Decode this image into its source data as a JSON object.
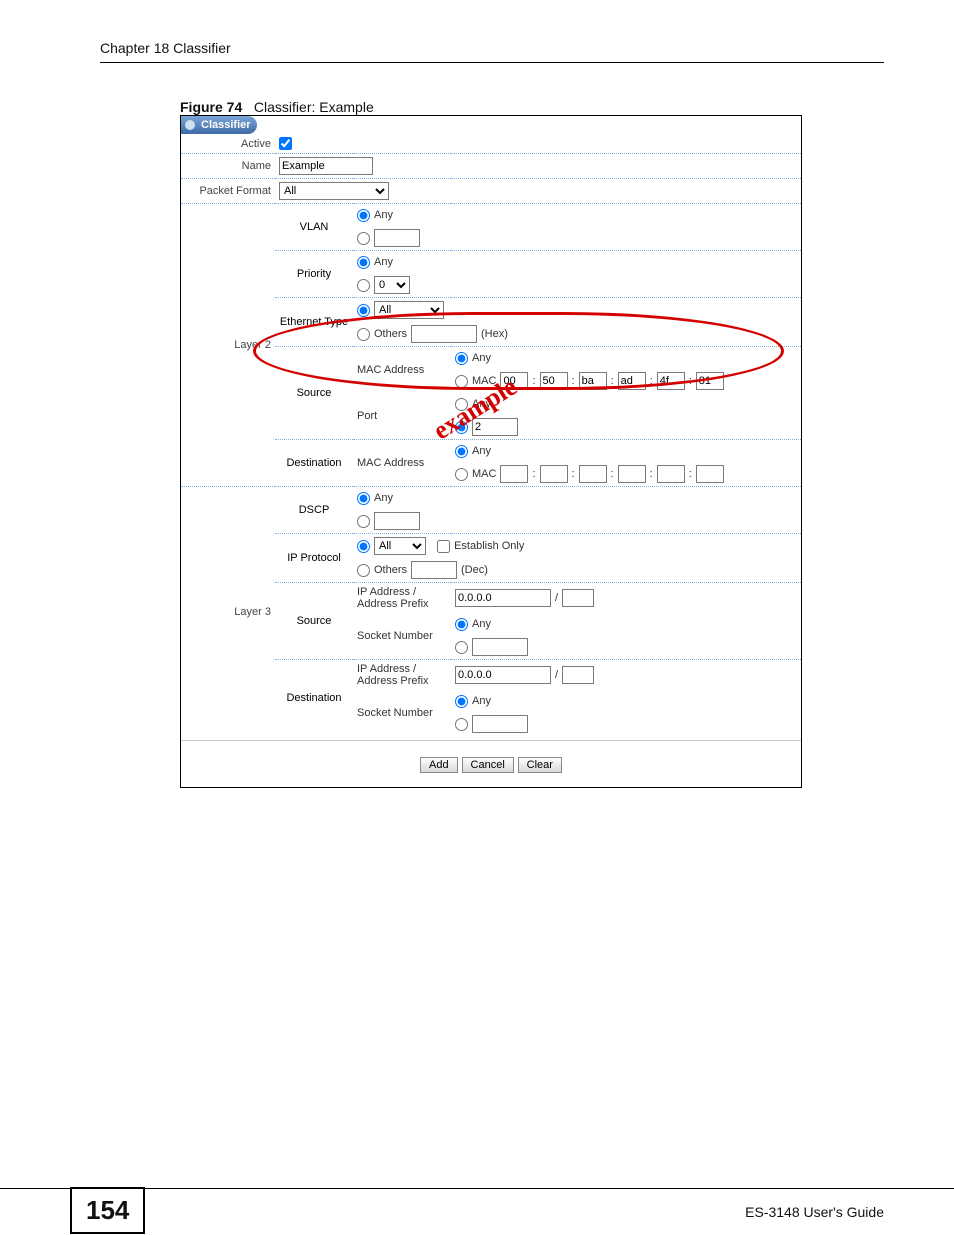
{
  "header": {
    "chapter": "Chapter 18 Classifier"
  },
  "figure": {
    "label": "Figure 74",
    "caption": "Classifier: Example"
  },
  "tab": {
    "title": "Classifier"
  },
  "rows": {
    "active": "Active",
    "name": "Name",
    "name_value": "Example",
    "packet_format": "Packet Format",
    "packet_format_value": "All"
  },
  "layer2": {
    "title": "Layer 2",
    "vlan": {
      "label": "VLAN",
      "any": "Any"
    },
    "priority": {
      "label": "Priority",
      "any": "Any",
      "value": "0"
    },
    "eth": {
      "label": "Ethernet Type",
      "sel": "All",
      "others": "Others",
      "hex": "(Hex)"
    },
    "source": {
      "label": "Source",
      "mac_label": "MAC Address",
      "mac_any": "Any",
      "mac_prefix": "MAC",
      "mac": [
        "00",
        "50",
        "ba",
        "ad",
        "4f",
        "81"
      ],
      "port_label": "Port",
      "port_any": "Any",
      "port_value": "2"
    },
    "dest": {
      "label": "Destination",
      "mac_label": "MAC Address",
      "mac_any": "Any",
      "mac_prefix": "MAC"
    }
  },
  "layer3": {
    "title": "Layer 3",
    "dscp": {
      "label": "DSCP",
      "any": "Any"
    },
    "ip_proto": {
      "label": "IP Protocol",
      "sel": "All",
      "establish": "Establish Only",
      "others": "Others",
      "dec": "(Dec)"
    },
    "source": {
      "label": "Source",
      "ip_label": "IP Address /",
      "prefix_label": "Address Prefix",
      "ip_value": "0.0.0.0",
      "slash": "/",
      "sock_label": "Socket Number",
      "sock_any": "Any"
    },
    "dest": {
      "label": "Destination",
      "ip_label": "IP Address /",
      "prefix_label": "Address Prefix",
      "ip_value": "0.0.0.0",
      "slash": "/",
      "sock_label": "Socket Number",
      "sock_any": "Any"
    }
  },
  "buttons": {
    "add": "Add",
    "cancel": "Cancel",
    "clear": "Clear"
  },
  "stamp": "example",
  "footer": {
    "page": "154",
    "guide": "ES-3148 User's Guide"
  }
}
